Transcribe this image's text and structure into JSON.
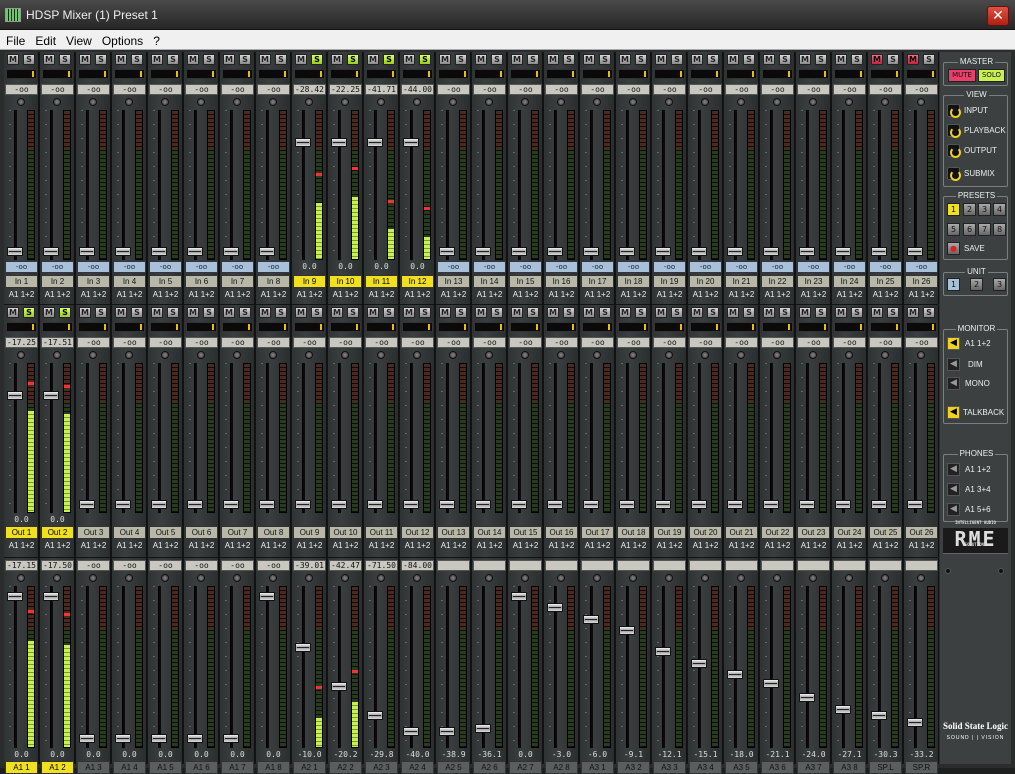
{
  "window": {
    "title": "HDSP Mixer (1) Preset 1",
    "close_label": "✕"
  },
  "menu": [
    "File",
    "Edit",
    "View",
    "Options",
    "?"
  ],
  "colors": {
    "solo_on": "#c8f050",
    "mute_on": "#e8406a",
    "label_active": "#f0e020",
    "meter_green": "#9acd32"
  },
  "input_row": {
    "levels": [
      "-oo",
      "-oo",
      "-oo",
      "-oo",
      "-oo",
      "-oo",
      "-oo",
      "-oo",
      "-28.42",
      "-22.25",
      "-41.71",
      "-44.00",
      "-oo",
      "-oo",
      "-oo",
      "-oo",
      "-oo",
      "-oo",
      "-oo",
      "-oo",
      "-oo",
      "-oo",
      "-oo",
      "-oo",
      "-oo",
      "-oo"
    ],
    "values": [
      "-oo",
      "-oo",
      "-oo",
      "-oo",
      "-oo",
      "-oo",
      "-oo",
      "-oo",
      "0.0",
      "0.0",
      "0.0",
      "0.0",
      "-oo",
      "-oo",
      "-oo",
      "-oo",
      "-oo",
      "-oo",
      "-oo",
      "-oo",
      "-oo",
      "-oo",
      "-oo",
      "-oo",
      "-oo",
      "-oo"
    ],
    "labels": [
      "In 1",
      "In 2",
      "In 3",
      "In 4",
      "In 5",
      "In 6",
      "In 7",
      "In 8",
      "In 9",
      "In 10",
      "In 11",
      "In 12",
      "In 13",
      "In 14",
      "In 15",
      "In 16",
      "In 17",
      "In 18",
      "In 19",
      "In 20",
      "In 21",
      "In 22",
      "In 23",
      "In 24",
      "In 25",
      "In 26"
    ],
    "routes": [
      "A1 1+2",
      "A1 1+2",
      "A1 1+2",
      "A1 1+2",
      "A1 1+2",
      "A1 1+2",
      "A1 1+2",
      "A1 1+2",
      "A1 1+2",
      "A1 1+2",
      "A1 1+2",
      "A1 1+2",
      "A1 1+2",
      "A1 1+2",
      "A1 1+2",
      "A1 1+2",
      "A1 1+2",
      "A1 1+2",
      "A1 1+2",
      "A1 1+2",
      "A1 1+2",
      "A1 1+2",
      "A1 1+2",
      "A1 1+2",
      "A1 1+2",
      "A1 1+2"
    ],
    "solo_on": [
      8,
      9,
      10,
      11
    ],
    "mute_on": [
      24,
      25
    ],
    "active": [
      8,
      9,
      10,
      11
    ],
    "meter": [
      0,
      0,
      0,
      0,
      0,
      0,
      0,
      0,
      0.38,
      0.42,
      0.2,
      0.15,
      0,
      0,
      0,
      0,
      0,
      0,
      0,
      0,
      0,
      0,
      0,
      0,
      0,
      0
    ],
    "fader": [
      0.03,
      0.03,
      0.03,
      0.03,
      0.03,
      0.03,
      0.03,
      0.03,
      0.8,
      0.8,
      0.8,
      0.8,
      0.03,
      0.03,
      0.03,
      0.03,
      0.03,
      0.03,
      0.03,
      0.03,
      0.03,
      0.03,
      0.03,
      0.03,
      0.03,
      0.03
    ]
  },
  "playback_row": {
    "levels": [
      "-17.25",
      "-17.51",
      "-oo",
      "-oo",
      "-oo",
      "-oo",
      "-oo",
      "-oo",
      "-oo",
      "-oo",
      "-oo",
      "-oo",
      "-oo",
      "-oo",
      "-oo",
      "-oo",
      "-oo",
      "-oo",
      "-oo",
      "-oo",
      "-oo",
      "-oo",
      "-oo",
      "-oo",
      "-oo",
      "-oo"
    ],
    "values": [
      "0.0",
      "0.0",
      "",
      "",
      "",
      "",
      "",
      "",
      "",
      "",
      "",
      "",
      "",
      "",
      "",
      "",
      "",
      "",
      "",
      "",
      "",
      "",
      "",
      "",
      "",
      ""
    ],
    "labels": [
      "Out 1",
      "Out 2",
      "Out 3",
      "Out 4",
      "Out 5",
      "Out 6",
      "Out 7",
      "Out 8",
      "Out 9",
      "Out 10",
      "Out 11",
      "Out 12",
      "Out 13",
      "Out 14",
      "Out 15",
      "Out 16",
      "Out 17",
      "Out 18",
      "Out 19",
      "Out 20",
      "Out 21",
      "Out 22",
      "Out 23",
      "Out 24",
      "Out 25",
      "Out 26"
    ],
    "routes": [
      "A1 1+2",
      "A1 1+2",
      "A1 1+2",
      "A1 1+2",
      "A1 1+2",
      "A1 1+2",
      "A1 1+2",
      "A1 1+2",
      "A1 1+2",
      "A1 1+2",
      "A1 1+2",
      "A1 1+2",
      "A1 1+2",
      "A1 1+2",
      "A1 1+2",
      "A1 1+2",
      "A1 1+2",
      "A1 1+2",
      "A1 1+2",
      "A1 1+2",
      "A1 1+2",
      "A1 1+2",
      "A1 1+2",
      "A1 1+2",
      "A1 1+2",
      "A1 1+2"
    ],
    "solo_on": [
      0,
      1
    ],
    "mute_on": [],
    "active": [
      0,
      1
    ],
    "meter": [
      0.68,
      0.66,
      0,
      0,
      0,
      0,
      0,
      0,
      0,
      0,
      0,
      0,
      0,
      0,
      0,
      0,
      0,
      0,
      0,
      0,
      0,
      0,
      0,
      0,
      0,
      0
    ],
    "fader": [
      0.8,
      0.8,
      0.03,
      0.03,
      0.03,
      0.03,
      0.03,
      0.03,
      0.03,
      0.03,
      0.03,
      0.03,
      0.03,
      0.03,
      0.03,
      0.03,
      0.03,
      0.03,
      0.03,
      0.03,
      0.03,
      0.03,
      0.03,
      0.03,
      0.03,
      0.03
    ]
  },
  "output_row": {
    "levels": [
      "-17.15",
      "-17.50",
      "-oo",
      "-oo",
      "-oo",
      "-oo",
      "-oo",
      "-oo",
      "-39.01",
      "-42.47",
      "-71.50",
      "-84.00",
      "",
      "",
      "",
      "",
      "",
      "",
      "",
      "",
      "",
      "",
      "",
      "",
      "",
      ""
    ],
    "values": [
      "0.0",
      "0.0",
      "0.0",
      "0.0",
      "0.0",
      "0.0",
      "0.0",
      "0.0",
      "-10.0",
      "-20.2",
      "-29.8",
      "-40.0",
      "-38.9",
      "-36.1",
      "0.0",
      "-3.0",
      "-6.0",
      "-9.1",
      "-12.1",
      "-15.1",
      "-18.0",
      "-21.1",
      "-24.0",
      "-27.1",
      "-30.3",
      "-33.2"
    ],
    "labels": [
      "A1 1",
      "A1 2",
      "A1 3",
      "A1 4",
      "A1 5",
      "A1 6",
      "A1 7",
      "A1 8",
      "A2 1",
      "A2 2",
      "A2 3",
      "A2 4",
      "A2 5",
      "A2 6",
      "A2 7",
      "A2 8",
      "A3 1",
      "A3 2",
      "A3 3",
      "A3 4",
      "A3 5",
      "A3 6",
      "A3 7",
      "A3 8",
      "SP.L",
      "SP.R"
    ],
    "active": [
      0,
      1
    ],
    "meter": [
      0.66,
      0.64,
      0,
      0,
      0,
      0,
      0,
      0,
      0.18,
      0.28,
      0,
      0,
      0,
      0,
      0,
      0,
      0,
      0,
      0,
      0,
      0,
      0,
      0,
      0,
      0,
      0
    ],
    "fader": [
      0.96,
      0.96,
      0.03,
      0.03,
      0.03,
      0.03,
      0.03,
      0.96,
      0.63,
      0.37,
      0.18,
      0.08,
      0.08,
      0.1,
      0.96,
      0.89,
      0.81,
      0.74,
      0.6,
      0.52,
      0.45,
      0.39,
      0.3,
      0.22,
      0.18,
      0.14
    ]
  },
  "side": {
    "master": {
      "title": "MASTER",
      "mute": "MUTE",
      "solo": "SOLO"
    },
    "view": {
      "title": "VIEW",
      "items": [
        "INPUT",
        "PLAYBACK",
        "OUTPUT",
        "SUBMIX"
      ]
    },
    "presets": {
      "title": "PRESETS",
      "buttons": [
        "1",
        "2",
        "3",
        "4",
        "5",
        "6",
        "7",
        "8"
      ],
      "save": "SAVE"
    },
    "unit": {
      "title": "UNIT",
      "buttons": [
        "1",
        "2",
        "3"
      ]
    },
    "monitor": {
      "title": "MONITOR",
      "items": [
        "A1 1+2",
        "DIM",
        "MONO",
        "TALKBACK"
      ]
    },
    "phones": {
      "title": "PHONES",
      "items": [
        "A1 1+2",
        "A1 3+4",
        "A1 5+6"
      ]
    },
    "logo": {
      "text": "RME",
      "sub": "INTELLIGENT AUDIO SOLUTIONS"
    },
    "ssl": {
      "line1": "Solid State Logic",
      "line2": "SOUND | | VISION"
    }
  }
}
